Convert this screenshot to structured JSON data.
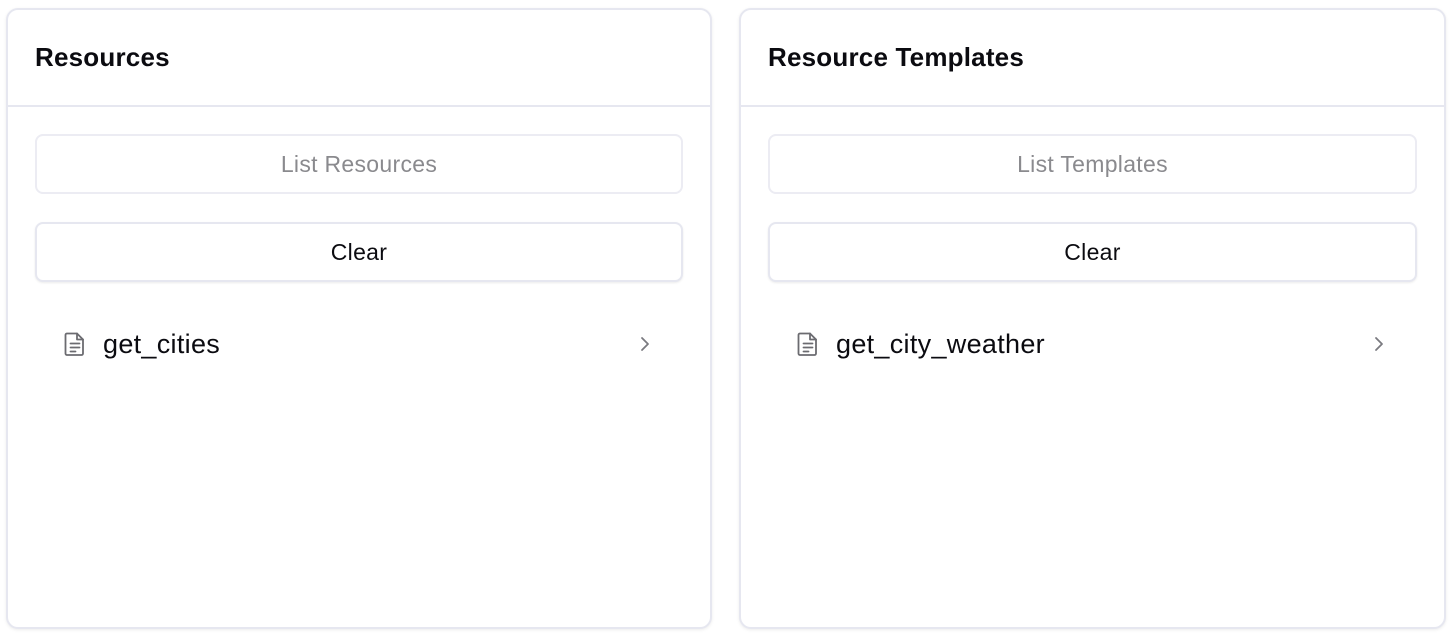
{
  "resources_panel": {
    "title": "Resources",
    "list_button_label": "List Resources",
    "clear_button_label": "Clear",
    "items": [
      {
        "label": "get_cities",
        "icon": "document-icon"
      }
    ]
  },
  "templates_panel": {
    "title": "Resource Templates",
    "list_button_label": "List Templates",
    "clear_button_label": "Clear",
    "items": [
      {
        "label": "get_city_weather",
        "icon": "document-icon"
      }
    ]
  },
  "colors": {
    "border": "#e6e7f0",
    "disabled_text": "#8a8a8e",
    "text": "#0b0b10",
    "icon": "#6b6b70"
  }
}
